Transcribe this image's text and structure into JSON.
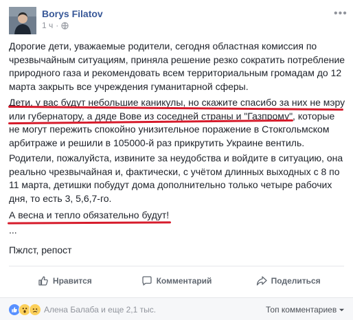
{
  "header": {
    "author": "Borys Filatov",
    "time": "1 ч",
    "dot": "·",
    "more": "•••"
  },
  "post": {
    "p1": "Дорогие дети, уважаемые родители, сегодня областная комиссия по чрезвычайным ситуациям, приняла решение резко сократить потребление природного газа и рекомендовать всем территориальным громадам до 12 марта закрыть все учреждения гуманитарной сферы.",
    "p2": "Дети, у вас будут небольшие каникулы, но скажите спасибо за них не мэру или губернатору, а дяде Вове из соседней страны и \"Газпрому\", которые не могут пережить спокойно унизительное поражение в Стокгольмском арбитраже и решили в 105000-й раз прикрутить Украине вентиль.",
    "p3": "Родители, пожалуйста, извините за неудобства и войдите в ситуацию, она реально чрезвычайная и, фактически, с учётом длинных выходных с 8 по 11 марта, детишки побудут дома дополнительно только четыре рабочих дня, то есть 3, 5,6,7-го.",
    "p4": "А весна и тепло обязательно будут!",
    "p5": "...",
    "p6": "Пжлст, репост"
  },
  "actions": {
    "like": "Нравится",
    "comment": "Комментарий",
    "share": "Поделиться"
  },
  "footer": {
    "reactions": "Алена Балаба и еще 2,1 тыс.",
    "sort": "Топ комментариев"
  },
  "colors": {
    "link": "#385898",
    "highlight": "#d61b2b",
    "like": "#5890ff"
  }
}
